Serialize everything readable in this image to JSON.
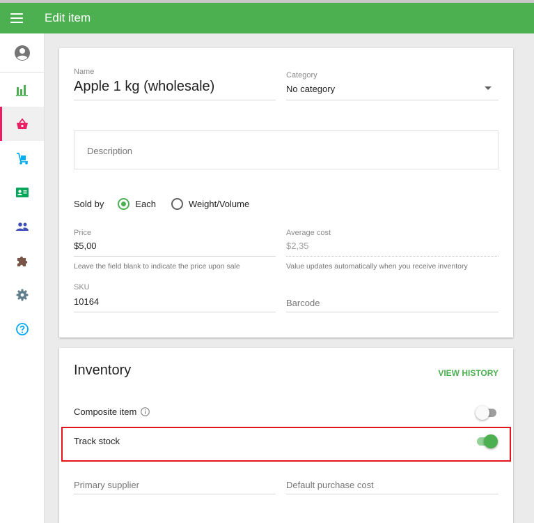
{
  "header": {
    "title": "Edit item"
  },
  "sidebar": {
    "items": [
      {
        "name": "reports",
        "icon": "bar-chart-icon",
        "color": "#4caf50"
      },
      {
        "name": "items",
        "icon": "basket-icon",
        "color": "#e91e63",
        "active": true
      },
      {
        "name": "inventory",
        "icon": "hand-truck-icon",
        "color": "#00aeef"
      },
      {
        "name": "employees",
        "icon": "id-card-icon",
        "color": "#00a65a"
      },
      {
        "name": "customers",
        "icon": "people-icon",
        "color": "#3f51b5"
      },
      {
        "name": "integrations",
        "icon": "puzzle-icon",
        "color": "#795548"
      },
      {
        "name": "settings",
        "icon": "gear-icon",
        "color": "#607d8b"
      },
      {
        "name": "help",
        "icon": "help-circle-icon",
        "color": "#03a9f4"
      }
    ]
  },
  "item": {
    "name_label": "Name",
    "name_value": "Apple 1 kg (wholesale)",
    "category_label": "Category",
    "category_value": "No category",
    "description_placeholder": "Description",
    "sold_by_label": "Sold by",
    "sold_by_options": [
      "Each",
      "Weight/Volume"
    ],
    "sold_by_selected": "Each",
    "price_label": "Price",
    "price_value": "$5,00",
    "price_hint": "Leave the field blank to indicate the price upon sale",
    "avg_cost_label": "Average cost",
    "avg_cost_value": "$2,35",
    "avg_cost_hint": "Value updates automatically when you receive inventory",
    "sku_label": "SKU",
    "sku_value": "10164",
    "barcode_placeholder": "Barcode"
  },
  "inventory": {
    "title": "Inventory",
    "view_history": "VIEW HISTORY",
    "composite_label": "Composite item",
    "composite_on": false,
    "track_stock_label": "Track stock",
    "track_stock_on": true,
    "primary_supplier_placeholder": "Primary supplier",
    "default_cost_placeholder": "Default purchase cost"
  },
  "colors": {
    "accent": "#4caf50",
    "active_nav": "#e91e63",
    "highlight": "#e4141b"
  }
}
